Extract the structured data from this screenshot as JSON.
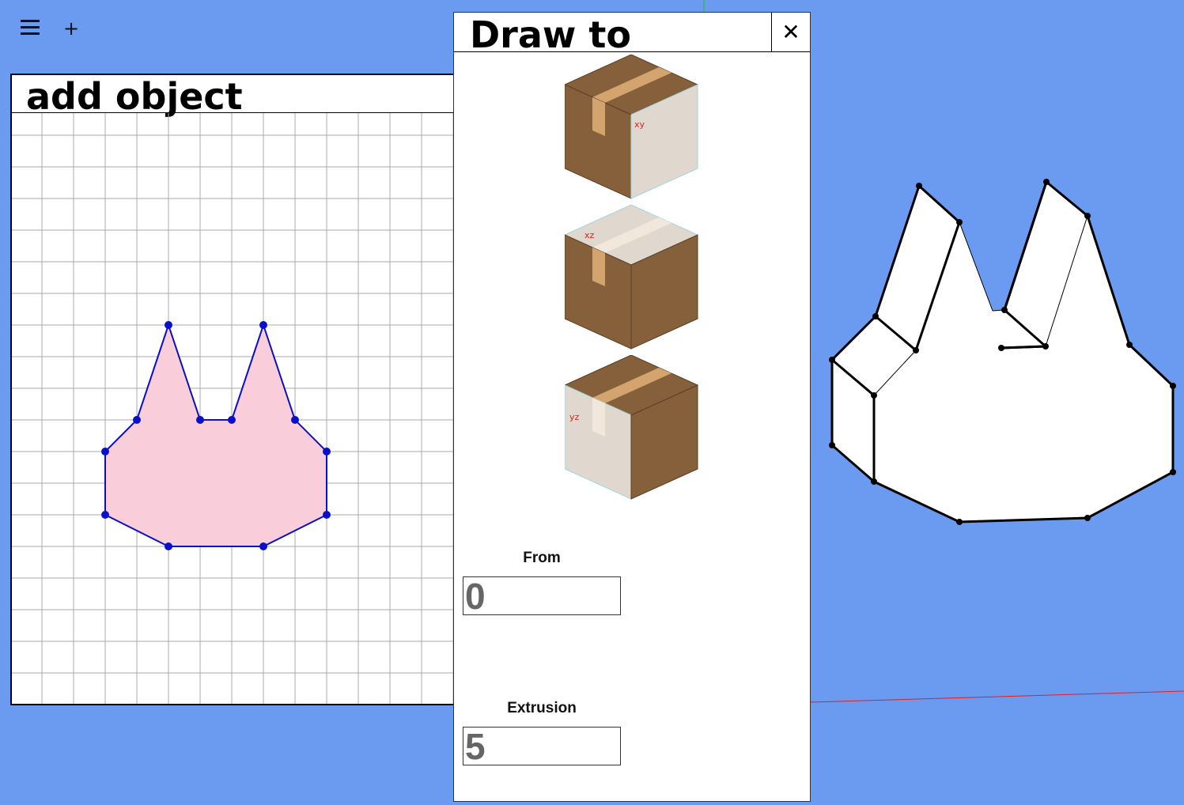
{
  "toolbar": {
    "menu_icon": "hamburger-icon",
    "add_label": "+"
  },
  "add_panel": {
    "title": "add object"
  },
  "draw_panel": {
    "title": "Draw to",
    "close_label": "✕",
    "planes": [
      {
        "name": "xy",
        "label": "xy"
      },
      {
        "name": "xz",
        "label": "xz"
      },
      {
        "name": "yz",
        "label": "yz"
      }
    ],
    "from_label": "From",
    "from_value": "0",
    "extrusion_label": "Extrusion",
    "extrusion_value": "5"
  },
  "colors": {
    "background": "#6a9bf0",
    "shape_fill": "#f9cdd9",
    "shape_stroke": "#0a10c8",
    "box_brown": "#85603b",
    "box_light": "#e0d8cf",
    "tape": "#d4a46f",
    "axis_red": "#e02020",
    "axis_green": "#20c020"
  }
}
